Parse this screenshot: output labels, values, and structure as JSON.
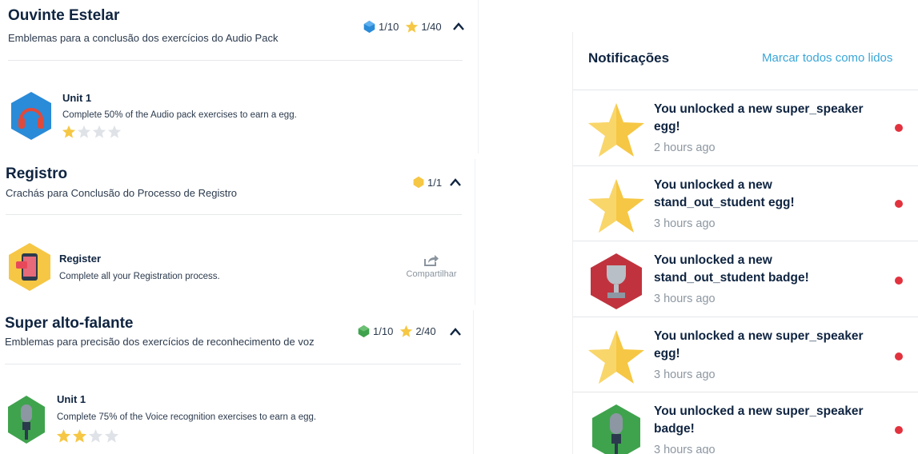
{
  "sections": [
    {
      "title": "Ouvinte Estelar",
      "subtitle": "Emblemas para a conclusão dos exercícios do Audio Pack",
      "badge_count": "1/10",
      "star_count": "1/40",
      "item": {
        "title": "Unit 1",
        "description": "Complete 50% of the Audio pack exercises to earn a egg.",
        "stars_filled": 1,
        "stars_total": 4,
        "icon": "headphones-icon"
      }
    },
    {
      "title": "Registro",
      "subtitle": "Crachás para Conclusão do Processo de Registro",
      "star_count": "1/1",
      "item": {
        "title": "Register",
        "description": "Complete all your Registration process.",
        "share_label": "Compartilhar",
        "icon": "register-phone-icon"
      }
    },
    {
      "title": "Super alto-falante",
      "subtitle": "Emblemas para precisão dos exercícios de reconhecimento de voz",
      "badge_count": "1/10",
      "star_count": "2/40",
      "item": {
        "title": "Unit 1",
        "description": "Complete 75% of the Voice recognition exercises to earn a egg.",
        "stars_filled": 2,
        "stars_total": 4,
        "icon": "microphone-icon"
      }
    }
  ],
  "notifications": {
    "title": "Notificações",
    "mark_all": "Marcar todos como lidos",
    "items": [
      {
        "message": "You unlocked a new super_speaker egg!",
        "time": "2 hours ago",
        "icon": "star-icon",
        "unread": true
      },
      {
        "message": "You unlocked a new stand_out_student egg!",
        "time": "3 hours ago",
        "icon": "star-icon",
        "unread": true
      },
      {
        "message": "You unlocked a new stand_out_student badge!",
        "time": "3 hours ago",
        "icon": "trophy-icon",
        "unread": true
      },
      {
        "message": "You unlocked a new super_speaker egg!",
        "time": "3 hours ago",
        "icon": "star-icon",
        "unread": true
      },
      {
        "message": "You unlocked a new super_speaker badge!",
        "time": "3 hours ago",
        "icon": "microphone-icon",
        "unread": true
      }
    ]
  },
  "colors": {
    "unread_dot": "#e2323e",
    "link": "#3aa6d8",
    "star": "#f6c744",
    "badge_blue": "#2a8bd8",
    "badge_green": "#3fa34d"
  }
}
